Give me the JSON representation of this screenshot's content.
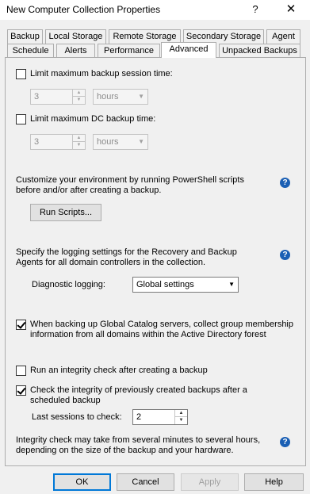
{
  "window": {
    "title": "New Computer Collection Properties",
    "help_glyph": "?",
    "close_glyph": "✕"
  },
  "tabs_row1": [
    "Backup",
    "Local Storage",
    "Remote Storage",
    "Secondary Storage",
    "Agent"
  ],
  "tabs_row2": [
    "Schedule",
    "Alerts",
    "Performance",
    "Advanced",
    "Unpacked Backups"
  ],
  "active_tab": "Advanced",
  "limit_session": {
    "label": "Limit maximum backup session time:",
    "checked": false,
    "value": "3",
    "unit": "hours"
  },
  "limit_dc": {
    "label": "Limit maximum DC backup time:",
    "checked": false,
    "value": "3",
    "unit": "hours"
  },
  "scripts": {
    "line1": "Customize your environment by running PowerShell scripts",
    "line2": "before and/or after creating a backup.",
    "button": "Run Scripts..."
  },
  "logging": {
    "line1": "Specify the logging settings for the Recovery and Backup",
    "line2": "Agents for all domain controllers in the collection.",
    "label": "Diagnostic logging:",
    "value": "Global settings"
  },
  "global_catalog": {
    "checked": true,
    "line1": "When backing up Global Catalog servers, collect group membership",
    "line2": "information from all domains within the Active Directory forest"
  },
  "integrity_after": {
    "checked": false,
    "label": "Run an integrity check after creating a backup"
  },
  "integrity_previous": {
    "checked": true,
    "line1": "Check the integrity of previously created backups after a",
    "line2": "scheduled backup",
    "sessions_label": "Last sessions to check:",
    "sessions_value": "2"
  },
  "integrity_note": {
    "line1": "Integrity check may take from several minutes to several hours,",
    "line2": "depending on the size of the backup and your hardware."
  },
  "buttons": {
    "ok": "OK",
    "cancel": "Cancel",
    "apply": "Apply",
    "help": "Help"
  },
  "glyphs": {
    "help_icon": "?",
    "spin_up": "▲",
    "spin_down": "▼",
    "dropdown": "▼"
  },
  "colors": {
    "accent": "#0078d7",
    "help_icon": "#1a5fb4"
  }
}
